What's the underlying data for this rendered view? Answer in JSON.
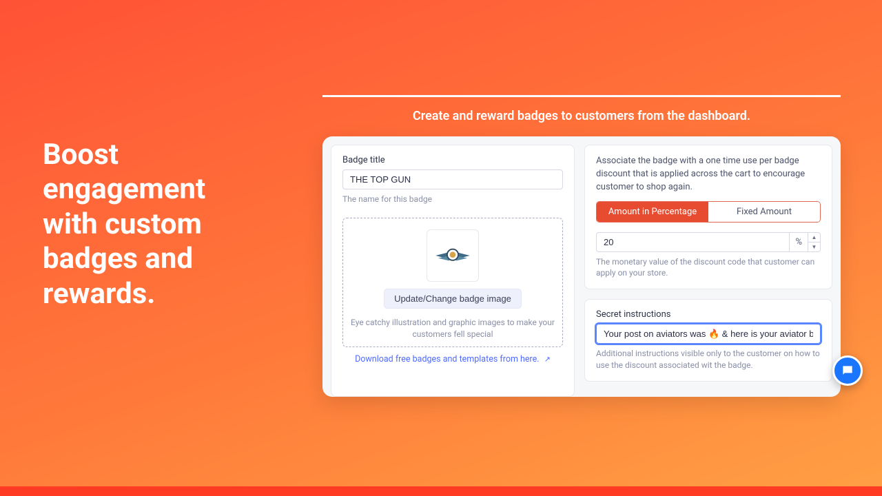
{
  "marketing": {
    "headline": "Boost\nengagement\nwith custom\nbadges and\nrewards.",
    "caption": "Create and reward badges to customers from the dashboard."
  },
  "left": {
    "title_label": "Badge title",
    "title_value": "THE TOP GUN",
    "title_helper": "The name for this badge",
    "update_btn": "Update/Change badge image",
    "image_helper": "Eye catchy illustration and graphic images to make your customers fell special",
    "download_link": "Download free badges and templates from here."
  },
  "right": {
    "associate_text": "Associate the badge with a one time use per badge discount that is applied across the cart to encourage customer to shop again.",
    "seg_percent": "Amount in Percentage",
    "seg_fixed": "Fixed Amount",
    "amount_value": "20",
    "amount_unit": "%",
    "amount_helper": "The monetary value of the discount code that customer can apply on your store.",
    "secret_label": "Secret instructions",
    "secret_value": "Your post on aviators was 🔥 & here is your aviator badge reward",
    "secret_helper": "Additional instructions visible only to the customer on how to use the discount associated wit the badge."
  }
}
